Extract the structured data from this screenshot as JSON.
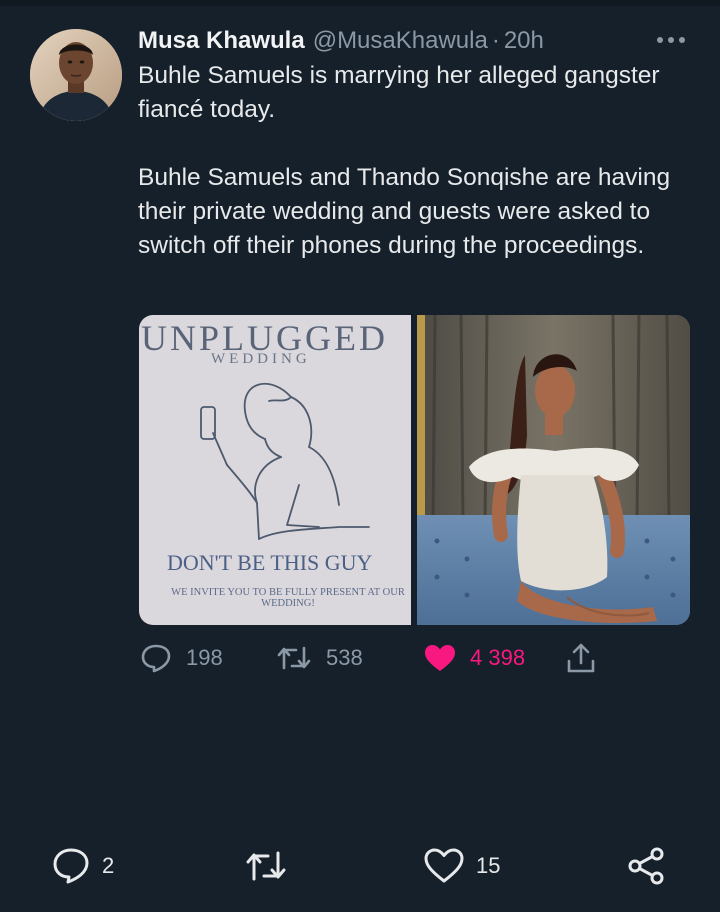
{
  "tweet": {
    "author": {
      "display_name": "Musa Khawula",
      "handle": "@MusaKhawula",
      "separator": "·",
      "time": "20h"
    },
    "text": [
      "Buhle Samuels is marrying her alleged gangster fiancé today.",
      "Buhle Samuels and Thando Sonqishe are having their private wedding and guests were asked to switch off their phones during the proceedings."
    ],
    "media": {
      "card_title": "UNPLUGGED",
      "card_subtitle": "WEDDING",
      "card_line1": "DON'T BE THIS GUY",
      "card_line2": "WE INVITE YOU TO BE FULLY PRESENT AT OUR WEDDING!"
    },
    "actions": {
      "reply_count": "198",
      "retweet_count": "538",
      "like_count": "4 398",
      "like_color": "#f91880"
    }
  },
  "bottom_bar": {
    "reply_count": "2",
    "like_count": "15"
  },
  "icons": {
    "more": "more-icon",
    "reply": "reply-icon",
    "retweet": "retweet-icon",
    "like": "heart-filled-icon",
    "share": "share-icon",
    "bottom_share": "share-nodes-icon"
  },
  "colors": {
    "background": "#15202b",
    "text": "#e7e9ea",
    "secondary": "#8b98a5",
    "like": "#f91880"
  }
}
